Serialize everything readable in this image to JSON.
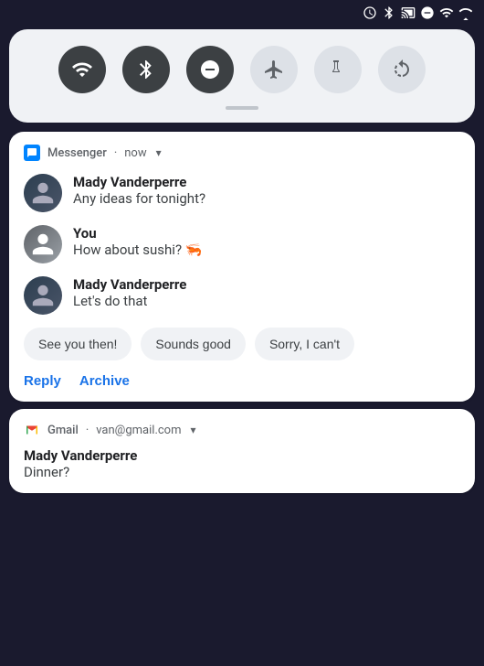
{
  "statusBar": {
    "icons": [
      "alarm",
      "bluetooth",
      "cast",
      "dnd",
      "wifi",
      "signal"
    ]
  },
  "quickSettings": {
    "buttons": [
      {
        "id": "wifi",
        "label": "Wi-Fi",
        "active": true,
        "symbol": "▾"
      },
      {
        "id": "bluetooth",
        "label": "Bluetooth",
        "active": true,
        "symbol": "⬡"
      },
      {
        "id": "dnd",
        "label": "Do Not Disturb",
        "active": true,
        "symbol": "—"
      },
      {
        "id": "airplane",
        "label": "Airplane Mode",
        "active": false,
        "symbol": "✈"
      },
      {
        "id": "flashlight",
        "label": "Flashlight",
        "active": false,
        "symbol": "⚡"
      },
      {
        "id": "rotate",
        "label": "Auto Rotate",
        "active": false,
        "symbol": "⟳"
      }
    ]
  },
  "messengerNotif": {
    "appName": "Messenger",
    "time": "now",
    "messages": [
      {
        "sender": "Mady Vanderperre",
        "text": "Any ideas for tonight?",
        "avatarType": "mady"
      },
      {
        "sender": "You",
        "text": "How about sushi? 🦐",
        "avatarType": "you"
      },
      {
        "sender": "Mady Vanderperre",
        "text": "Let's do that",
        "avatarType": "mady"
      }
    ],
    "quickReplies": [
      "See you then!",
      "Sounds good",
      "Sorry, I can't"
    ],
    "actions": [
      "Reply",
      "Archive"
    ]
  },
  "gmailNotif": {
    "appName": "Gmail",
    "account": "van@gmail.com",
    "sender": "Mady Vanderperre",
    "subject": "Dinner?"
  }
}
